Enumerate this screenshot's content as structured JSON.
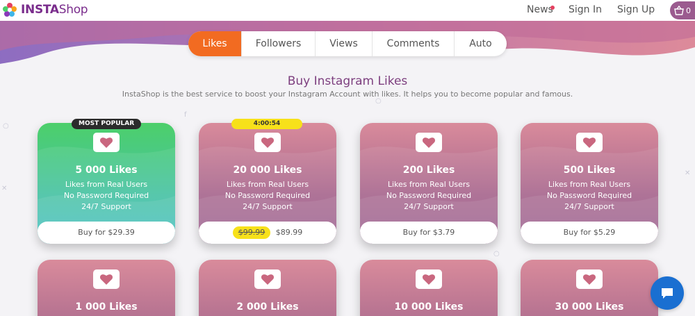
{
  "header": {
    "brand_bold": "INSTA",
    "brand_light": "Shop",
    "nav": {
      "news": "News",
      "signin": "Sign In",
      "signup": "Sign Up"
    },
    "cart_count": "0"
  },
  "tabs": [
    "Likes",
    "Followers",
    "Views",
    "Comments",
    "Auto"
  ],
  "active_tab": "Likes",
  "main": {
    "title": "Buy Instagram Likes",
    "subtitle": "InstaShop is the best service to boost your Instagram Account with likes. It helps you to become popular and famous."
  },
  "features": [
    "Likes from Real Users",
    "No Password Required",
    "24/7 Support"
  ],
  "cards": [
    {
      "title": "5 000 Likes",
      "badge": "MOST POPULAR",
      "buy": "Buy for $29.39"
    },
    {
      "title": "20 000 Likes",
      "badge": "4:00:54",
      "old_price": "$99.99",
      "price": "$89.99"
    },
    {
      "title": "200 Likes",
      "buy": "Buy for $3.79"
    },
    {
      "title": "500 Likes",
      "buy": "Buy for $5.29"
    }
  ],
  "cards_row2": [
    {
      "title": "1 000 Likes"
    },
    {
      "title": "2 000 Likes"
    },
    {
      "title": "10 000 Likes"
    },
    {
      "title": "30 000 Likes"
    }
  ],
  "colors": {
    "accent_orange": "#f26b21",
    "card_pink": "#c97c96",
    "card_green": "#4ccf6a",
    "badge_yellow": "#f7e11a",
    "chat_blue": "#1a6fd1",
    "brand_purple": "#7a2d8c"
  },
  "icons": {
    "logo": "colorful-flower-logo-icon",
    "cart": "basket-icon",
    "card": "heart-icon",
    "chat": "chat-bubble-icon"
  }
}
